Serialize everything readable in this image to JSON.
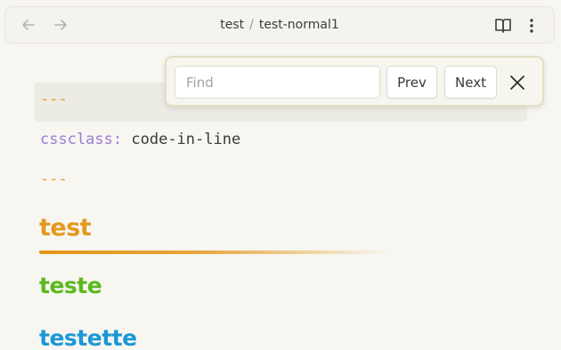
{
  "topbar": {
    "back_icon": "arrow-left-icon",
    "forward_icon": "arrow-right-icon",
    "breadcrumb": {
      "folder": "test",
      "separator": "/",
      "file": "test-normal1"
    },
    "reading_view_icon": "book-open-icon",
    "more_icon": "more-vertical-icon"
  },
  "document": {
    "frontmatter_open": "---",
    "frontmatter_key": "cssclass",
    "frontmatter_colon": ":",
    "frontmatter_value": " code-in-line",
    "frontmatter_close": "---",
    "heading1": "test",
    "heading2": "teste",
    "heading3": "testette"
  },
  "find": {
    "placeholder": "Find",
    "value": "",
    "prev_label": "Prev",
    "next_label": "Next",
    "close_icon": "close-icon"
  },
  "colors": {
    "background": "#f7f6f1",
    "heading1": "#e3991d",
    "heading2": "#5cb81e",
    "heading3": "#1c98d6",
    "frontmatter_key": "#9a7bd6",
    "frontmatter_dashes": "#e0a030"
  }
}
